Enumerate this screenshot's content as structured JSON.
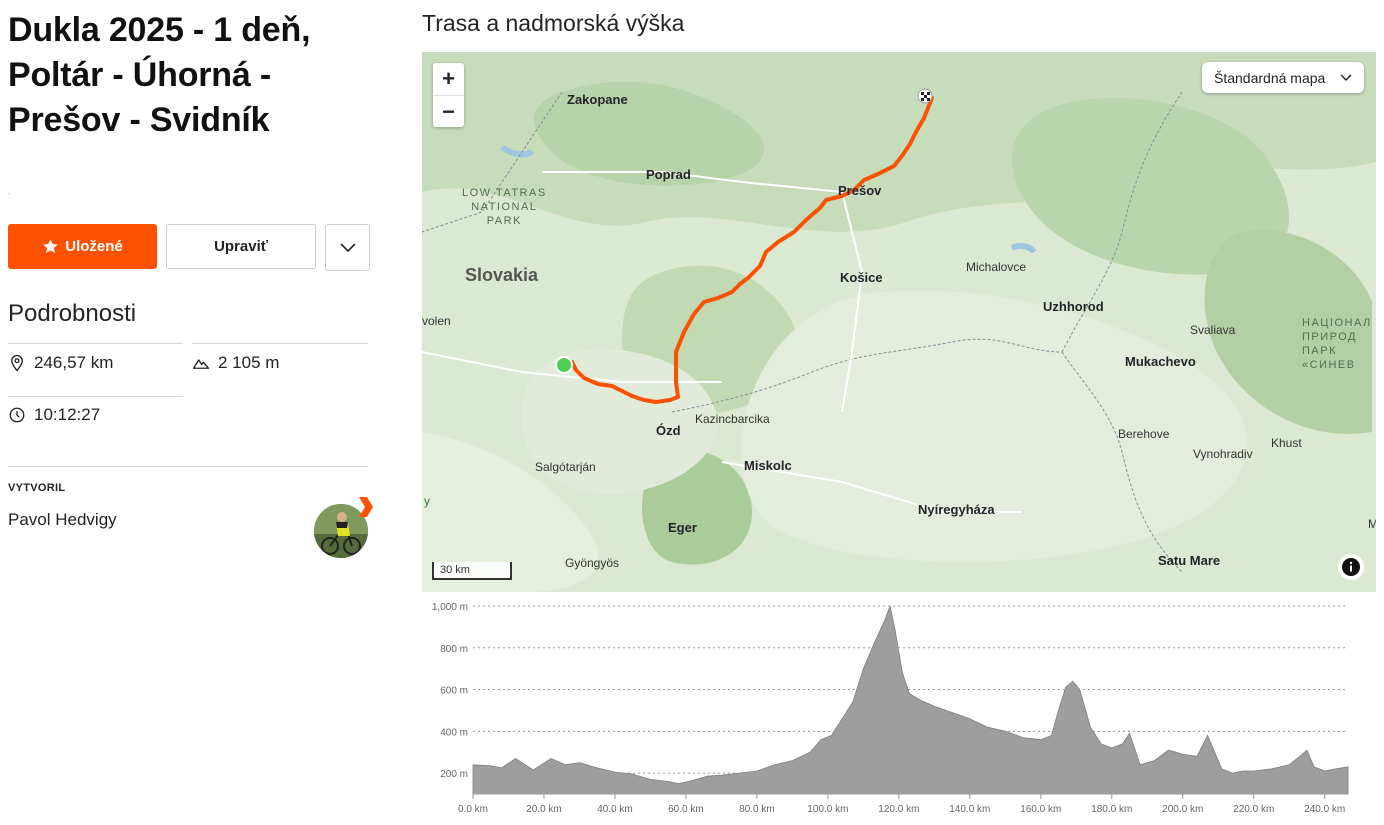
{
  "route": {
    "title": "Dukla 2025 - 1 deň,\nPoltár - Úhorná -\nPrešov - Svidník",
    "tiny_mark": "."
  },
  "actions": {
    "saved_label": "Uložené",
    "edit_label": "Upraviť"
  },
  "details": {
    "heading": "Podrobnosti",
    "distance": "246,57 km",
    "elevation_gain": "2 105 m",
    "time": "10:12:27"
  },
  "creator": {
    "label": "VYTVORIL",
    "name": "Pavol Hedvigy"
  },
  "map": {
    "heading": "Trasa a nadmorská výška",
    "style_select": "Štandardná mapa",
    "zoom_in": "+",
    "zoom_out": "−",
    "scale": "30 km",
    "route_color": "#fc5200",
    "labels": {
      "zakopane": "Zakopane",
      "poprad": "Poprad",
      "low_tatras": "LOW TATRAS\nNATIONAL\nPARK",
      "slovakia": "Slovakia",
      "zvolen": "volen",
      "presov": "Prešov",
      "kosice": "Košice",
      "michalovce": "Michalovce",
      "uzhhorod": "Uzhhorod",
      "svaliava": "Svaliava",
      "mukachevo": "Mukachevo",
      "nat_park_ua": "НАЦІОНАЛ\nПРИРОД\nПАРК\n«СИНЕВ",
      "ozd": "Ózd",
      "kazincbarcika": "Kazincbarcika",
      "salgotarjan": "Salgótarján",
      "miskolc": "Miskolc",
      "berehove": "Berehove",
      "vynohradiv": "Vynohradiv",
      "khust": "Khust",
      "nyiregyhaza": "Nyíregyháza",
      "eger": "Eger",
      "gyongyos": "Gyöngyös",
      "satu_mare": "Satu Mare",
      "edge_y": "y",
      "edge_m": "M"
    }
  },
  "chart_data": {
    "type": "area",
    "title": "",
    "xlabel": "",
    "ylabel": "",
    "x_unit": "km",
    "y_unit": "m",
    "xlim": [
      0,
      246.57
    ],
    "ylim": [
      100,
      1000
    ],
    "y_ticks": [
      "200 m",
      "400 m",
      "600 m",
      "800 m",
      "1,000 m"
    ],
    "y_tick_values": [
      200,
      400,
      600,
      800,
      1000
    ],
    "x_ticks": [
      "0.0 km",
      "20.0 km",
      "40.0 km",
      "60.0 km",
      "80.0 km",
      "100.0 km",
      "120.0 km",
      "140.0 km",
      "160.0 km",
      "180.0 km",
      "200.0 km",
      "220.0 km",
      "240.0 km"
    ],
    "x_tick_values": [
      0,
      20,
      40,
      60,
      80,
      100,
      120,
      140,
      160,
      180,
      200,
      220,
      240
    ],
    "fill_color": "#9e9e9e",
    "grid": true,
    "x": [
      0,
      5,
      8,
      12,
      17,
      22,
      26,
      30,
      35,
      40,
      45,
      50,
      55,
      58,
      62,
      66,
      70,
      75,
      80,
      85,
      90,
      95,
      98,
      101,
      104,
      107,
      110,
      113,
      116,
      117.5,
      119,
      121,
      123,
      126,
      130,
      135,
      140,
      145,
      150,
      155,
      160,
      163,
      165,
      167,
      169,
      171,
      174,
      177,
      180,
      183,
      185,
      188,
      192,
      196,
      200,
      204,
      207,
      209,
      211,
      214,
      217,
      220,
      225,
      230,
      233,
      235,
      237,
      240,
      243,
      246.57
    ],
    "y": [
      240,
      235,
      225,
      270,
      215,
      270,
      240,
      250,
      225,
      205,
      195,
      170,
      160,
      150,
      165,
      185,
      190,
      200,
      210,
      240,
      260,
      300,
      360,
      380,
      460,
      540,
      700,
      820,
      930,
      1000,
      880,
      680,
      580,
      550,
      520,
      490,
      460,
      420,
      400,
      370,
      360,
      380,
      500,
      610,
      640,
      600,
      420,
      340,
      320,
      340,
      390,
      240,
      260,
      310,
      290,
      280,
      380,
      300,
      220,
      200,
      210,
      210,
      220,
      240,
      280,
      310,
      230,
      210,
      220,
      230
    ]
  }
}
